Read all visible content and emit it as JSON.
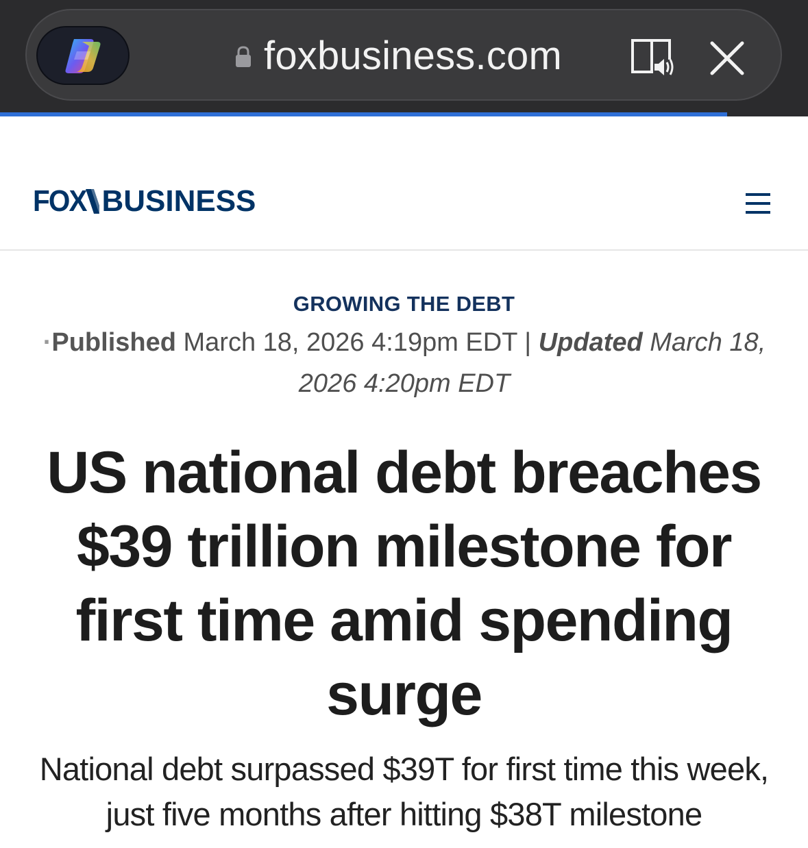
{
  "browser": {
    "url": "foxbusiness.com",
    "secure": true,
    "load_progress": 0.9
  },
  "site": {
    "logo_fox": "FOX",
    "logo_business": "BUSINESS",
    "brand_color": "#003366",
    "accent_red": "#c8102e"
  },
  "article": {
    "eyebrow": "GROWING THE DEBT",
    "published_label": "Published",
    "published_value": " March 18, 2026 4:19pm EDT | ",
    "updated_label": "Updated",
    "updated_value": " March 18, 2026 4:20pm EDT",
    "headline": "US national debt breaches $39 trillion milestone for first time amid spending surge",
    "subheadline": "National debt surpassed $39T for first time this week, just five months after hitting $38T milestone"
  },
  "icons": {
    "copilot": "copilot-icon",
    "lock": "lock-icon",
    "reader": "reader-listen-icon",
    "close": "close-icon",
    "menu": "hamburger-menu-icon"
  }
}
